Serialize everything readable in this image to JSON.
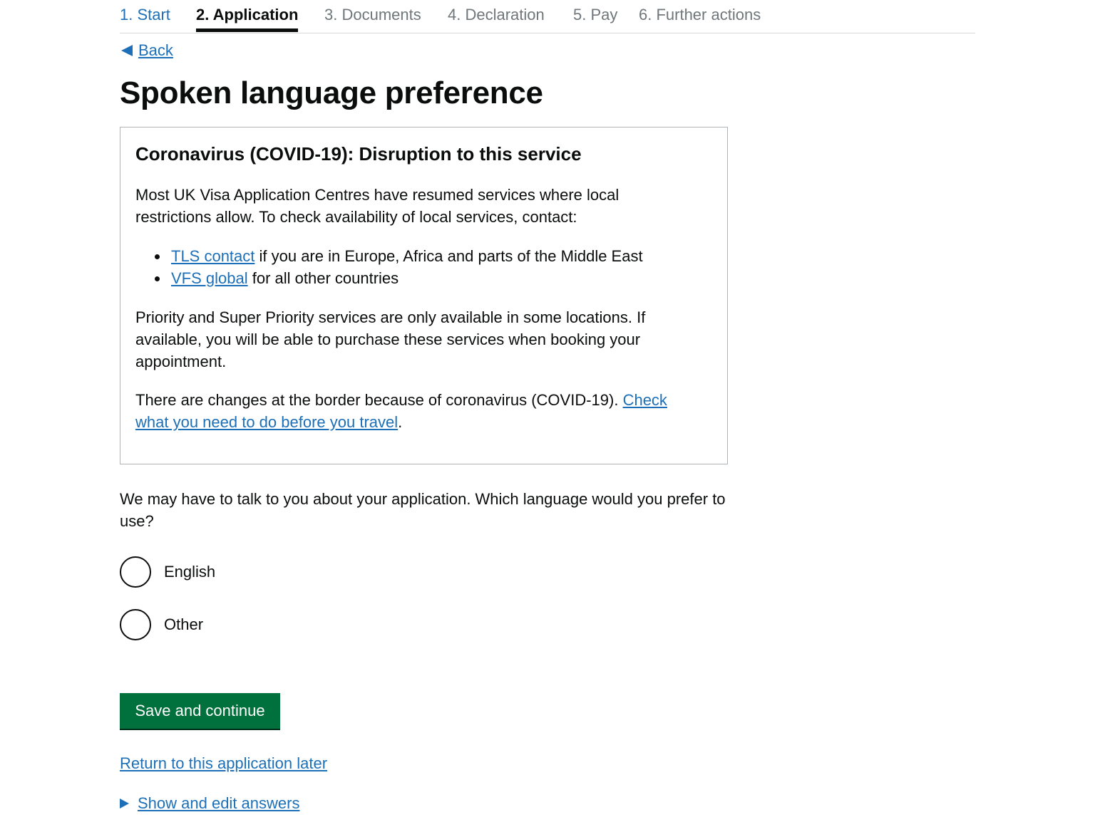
{
  "steps": [
    {
      "label": "1. Start",
      "state": "done"
    },
    {
      "label": "2. Application",
      "state": "current"
    },
    {
      "label": "3. Documents",
      "state": "future"
    },
    {
      "label": "4. Declaration",
      "state": "future"
    },
    {
      "label": "5. Pay",
      "state": "future"
    },
    {
      "label": "6. Further actions",
      "state": "future"
    }
  ],
  "back_link": "Back",
  "page_title": "Spoken language preference",
  "notice": {
    "heading": "Coronavirus (COVID-19): Disruption to this service",
    "para1": "Most UK Visa Application Centres have resumed services where local restrictions allow. To check availability of local services, contact:",
    "items": [
      {
        "link": "TLS contact",
        "text": " if you are in Europe, Africa and parts of the Middle East"
      },
      {
        "link": "VFS global",
        "text": " for all other countries"
      }
    ],
    "para2": "Priority and Super Priority services are only available in some locations. If available, you will be able to purchase these services when booking your appointment.",
    "para3_text": "There are changes at the border because of coronavirus (COVID-19). ",
    "para3_link": "Check what you need to do before you travel",
    "para3_end": "."
  },
  "question": "We may have to talk to you about your application. Which language would you prefer to use?",
  "options": [
    {
      "label": "English",
      "selected": false
    },
    {
      "label": "Other",
      "selected": false
    }
  ],
  "submit_label": "Save and continue",
  "return_link": "Return to this application later",
  "details_link": "Show and edit answers",
  "colors": {
    "link": "#1d70b8",
    "button": "#00703c",
    "text": "#0b0c0c",
    "muted": "#6f777b"
  }
}
